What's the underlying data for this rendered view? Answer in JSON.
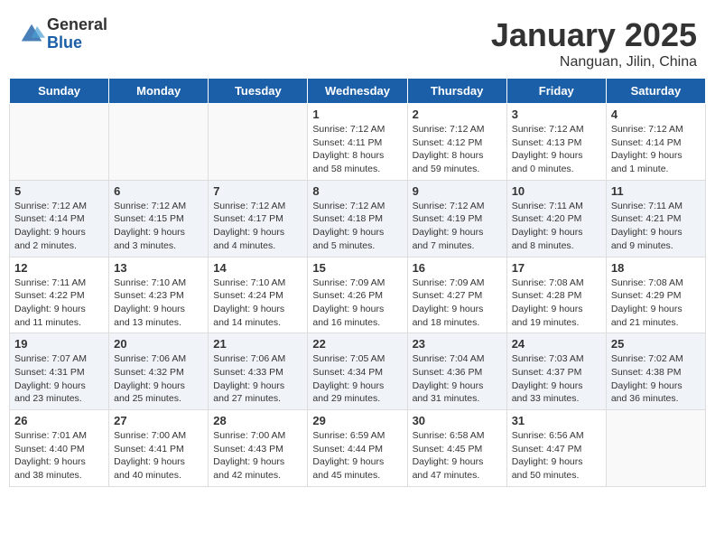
{
  "header": {
    "logo_general": "General",
    "logo_blue": "Blue",
    "month": "January 2025",
    "location": "Nanguan, Jilin, China"
  },
  "weekdays": [
    "Sunday",
    "Monday",
    "Tuesday",
    "Wednesday",
    "Thursday",
    "Friday",
    "Saturday"
  ],
  "weeks": [
    [
      {
        "day": "",
        "info": ""
      },
      {
        "day": "",
        "info": ""
      },
      {
        "day": "",
        "info": ""
      },
      {
        "day": "1",
        "info": "Sunrise: 7:12 AM\nSunset: 4:11 PM\nDaylight: 8 hours\nand 58 minutes."
      },
      {
        "day": "2",
        "info": "Sunrise: 7:12 AM\nSunset: 4:12 PM\nDaylight: 8 hours\nand 59 minutes."
      },
      {
        "day": "3",
        "info": "Sunrise: 7:12 AM\nSunset: 4:13 PM\nDaylight: 9 hours\nand 0 minutes."
      },
      {
        "day": "4",
        "info": "Sunrise: 7:12 AM\nSunset: 4:14 PM\nDaylight: 9 hours\nand 1 minute."
      }
    ],
    [
      {
        "day": "5",
        "info": "Sunrise: 7:12 AM\nSunset: 4:14 PM\nDaylight: 9 hours\nand 2 minutes."
      },
      {
        "day": "6",
        "info": "Sunrise: 7:12 AM\nSunset: 4:15 PM\nDaylight: 9 hours\nand 3 minutes."
      },
      {
        "day": "7",
        "info": "Sunrise: 7:12 AM\nSunset: 4:17 PM\nDaylight: 9 hours\nand 4 minutes."
      },
      {
        "day": "8",
        "info": "Sunrise: 7:12 AM\nSunset: 4:18 PM\nDaylight: 9 hours\nand 5 minutes."
      },
      {
        "day": "9",
        "info": "Sunrise: 7:12 AM\nSunset: 4:19 PM\nDaylight: 9 hours\nand 7 minutes."
      },
      {
        "day": "10",
        "info": "Sunrise: 7:11 AM\nSunset: 4:20 PM\nDaylight: 9 hours\nand 8 minutes."
      },
      {
        "day": "11",
        "info": "Sunrise: 7:11 AM\nSunset: 4:21 PM\nDaylight: 9 hours\nand 9 minutes."
      }
    ],
    [
      {
        "day": "12",
        "info": "Sunrise: 7:11 AM\nSunset: 4:22 PM\nDaylight: 9 hours\nand 11 minutes."
      },
      {
        "day": "13",
        "info": "Sunrise: 7:10 AM\nSunset: 4:23 PM\nDaylight: 9 hours\nand 13 minutes."
      },
      {
        "day": "14",
        "info": "Sunrise: 7:10 AM\nSunset: 4:24 PM\nDaylight: 9 hours\nand 14 minutes."
      },
      {
        "day": "15",
        "info": "Sunrise: 7:09 AM\nSunset: 4:26 PM\nDaylight: 9 hours\nand 16 minutes."
      },
      {
        "day": "16",
        "info": "Sunrise: 7:09 AM\nSunset: 4:27 PM\nDaylight: 9 hours\nand 18 minutes."
      },
      {
        "day": "17",
        "info": "Sunrise: 7:08 AM\nSunset: 4:28 PM\nDaylight: 9 hours\nand 19 minutes."
      },
      {
        "day": "18",
        "info": "Sunrise: 7:08 AM\nSunset: 4:29 PM\nDaylight: 9 hours\nand 21 minutes."
      }
    ],
    [
      {
        "day": "19",
        "info": "Sunrise: 7:07 AM\nSunset: 4:31 PM\nDaylight: 9 hours\nand 23 minutes."
      },
      {
        "day": "20",
        "info": "Sunrise: 7:06 AM\nSunset: 4:32 PM\nDaylight: 9 hours\nand 25 minutes."
      },
      {
        "day": "21",
        "info": "Sunrise: 7:06 AM\nSunset: 4:33 PM\nDaylight: 9 hours\nand 27 minutes."
      },
      {
        "day": "22",
        "info": "Sunrise: 7:05 AM\nSunset: 4:34 PM\nDaylight: 9 hours\nand 29 minutes."
      },
      {
        "day": "23",
        "info": "Sunrise: 7:04 AM\nSunset: 4:36 PM\nDaylight: 9 hours\nand 31 minutes."
      },
      {
        "day": "24",
        "info": "Sunrise: 7:03 AM\nSunset: 4:37 PM\nDaylight: 9 hours\nand 33 minutes."
      },
      {
        "day": "25",
        "info": "Sunrise: 7:02 AM\nSunset: 4:38 PM\nDaylight: 9 hours\nand 36 minutes."
      }
    ],
    [
      {
        "day": "26",
        "info": "Sunrise: 7:01 AM\nSunset: 4:40 PM\nDaylight: 9 hours\nand 38 minutes."
      },
      {
        "day": "27",
        "info": "Sunrise: 7:00 AM\nSunset: 4:41 PM\nDaylight: 9 hours\nand 40 minutes."
      },
      {
        "day": "28",
        "info": "Sunrise: 7:00 AM\nSunset: 4:43 PM\nDaylight: 9 hours\nand 42 minutes."
      },
      {
        "day": "29",
        "info": "Sunrise: 6:59 AM\nSunset: 4:44 PM\nDaylight: 9 hours\nand 45 minutes."
      },
      {
        "day": "30",
        "info": "Sunrise: 6:58 AM\nSunset: 4:45 PM\nDaylight: 9 hours\nand 47 minutes."
      },
      {
        "day": "31",
        "info": "Sunrise: 6:56 AM\nSunset: 4:47 PM\nDaylight: 9 hours\nand 50 minutes."
      },
      {
        "day": "",
        "info": ""
      }
    ]
  ]
}
